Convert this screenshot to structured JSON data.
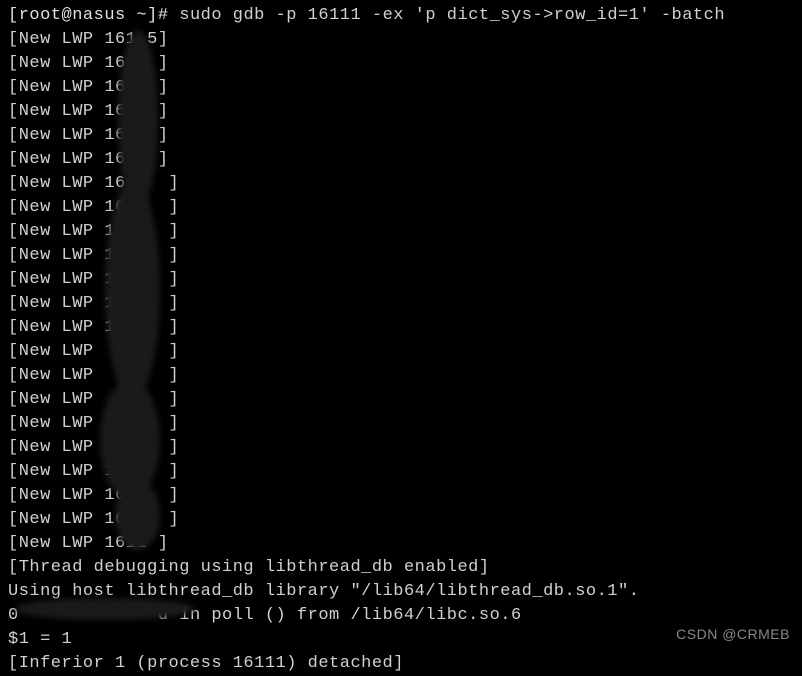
{
  "prompt": {
    "bracket_open": "[",
    "user": "root@nasus",
    "tilde": " ~",
    "bracket_close": "]# ",
    "command": "sudo gdb -p 16111 -ex 'p dict_sys->row_id=1' -batch"
  },
  "lwp_lines": [
    "[New LWP 161 5]",
    "[New LWP 1618 ]",
    "[New LWP 1614 ]",
    "[New LWP 1614 ]",
    "[New LWP 161  ]",
    "[New LWP 161  ]",
    "[New LWP 161   ]",
    "[New LWP 16    ]",
    "[New LWP 16    ]",
    "[New LWP 16    ]",
    "[New LWP 1     ]",
    "[New LWP 1     ]",
    "[New LWP 1     ]",
    "[New LWP       ]",
    "[New LWP       ]",
    "[New LWP       ]",
    "[New LWP       ]",
    "[New LWP 5     ]",
    "[New LWP 1     ]",
    "[New LWP 16    ]",
    "[New LWP 16.1  ]",
    "[New LWP 1611 ]"
  ],
  "thread_debug": "[Thread debugging using libthread_db enabled]",
  "using_host": "Using host libthread_db library \"/lib64/libthread_db.so.1\".",
  "poll_line_prefix": "0       ",
  "poll_line_suffix": "      d in poll () from /lib64/libc.so.6",
  "result": "$1 = 1",
  "detached": "[Inferior 1 (process 16111) detached]",
  "watermark": "CSDN @CRMEB"
}
